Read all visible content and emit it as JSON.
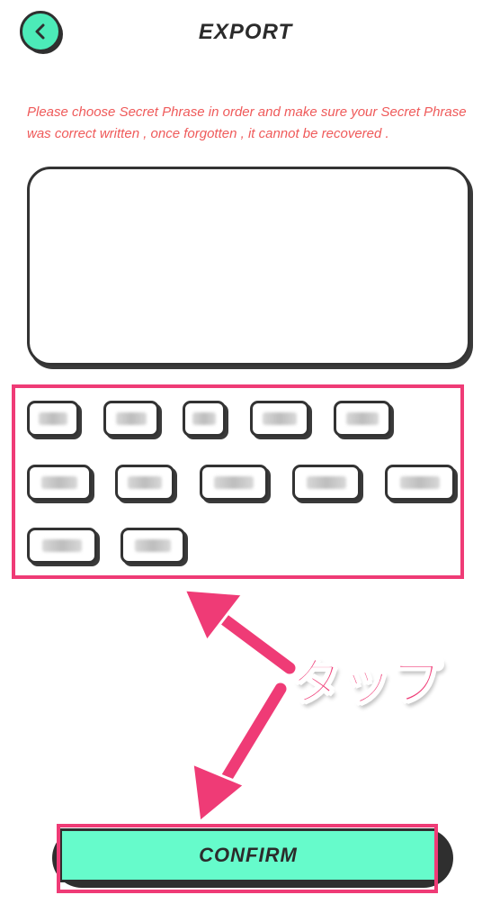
{
  "header": {
    "title": "EXPORT",
    "back_icon": "chevron-left-icon"
  },
  "warning_text": "Please choose Secret Phrase in order and make sure your Secret Phrase was correct written , once forgotten , it cannot be recovered .",
  "annotation": {
    "tap_label": "タップ"
  },
  "confirm": {
    "label": "CONFIRM"
  },
  "colors": {
    "accent_green": "#66fbcb",
    "back_green": "#4cebb8",
    "warning_red": "#ef5a5a",
    "highlight_pink": "#ef3b76"
  }
}
